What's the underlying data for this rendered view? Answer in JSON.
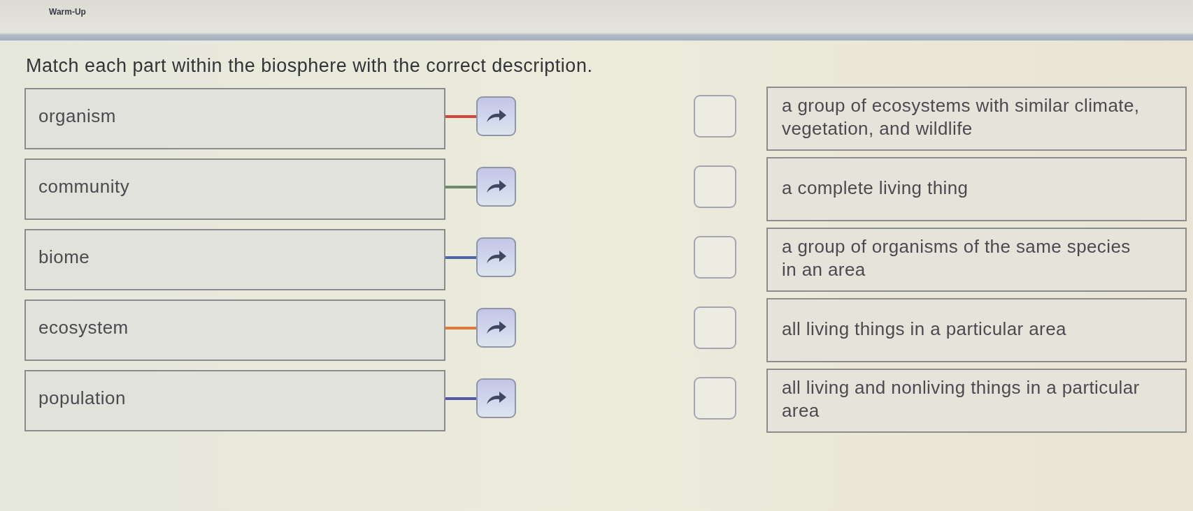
{
  "header": {
    "label": "Warm-Up"
  },
  "instruction": "Match each part within the biosphere with the correct description.",
  "rows": [
    {
      "term": "organism",
      "color": "#d6453d",
      "description": "a group of ecosystems with similar climate, vegetation, and wildlife"
    },
    {
      "term": "community",
      "color": "#6f8a6c",
      "description": "a complete living thing"
    },
    {
      "term": "biome",
      "color": "#4a68a8",
      "description": "a group of organisms of the same species in an area"
    },
    {
      "term": "ecosystem",
      "color": "#e07a3a",
      "description": "all living things in a particular area"
    },
    {
      "term": "population",
      "color": "#5558a6",
      "description": "all living and nonliving things in a particular area"
    }
  ]
}
